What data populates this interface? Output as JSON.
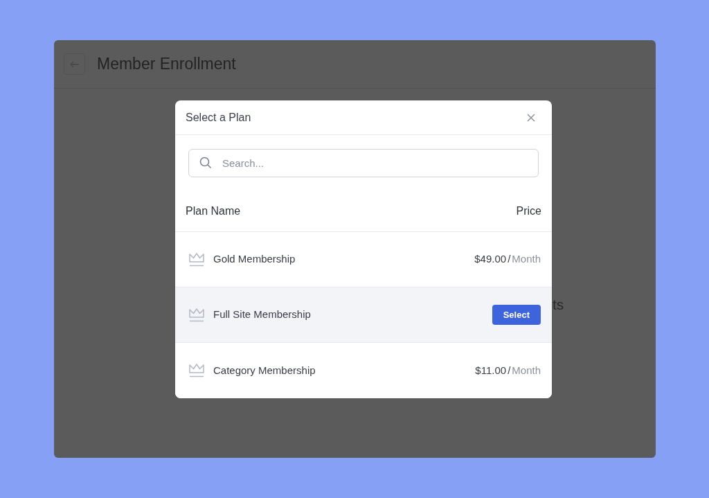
{
  "page": {
    "title": "Member Enrollment",
    "background_text": "ts"
  },
  "dialog": {
    "title": "Select a Plan",
    "search": {
      "placeholder": "Search..."
    },
    "columns": [
      "Plan Name",
      "Price"
    ],
    "rows": [
      {
        "name": "Gold Membership",
        "price": "$49.00",
        "separator": "/",
        "period": "Month",
        "highlighted": false
      },
      {
        "name": "Full Site Membership",
        "action": "Select",
        "highlighted": true
      },
      {
        "name": "Category Membership",
        "price": "$11.00",
        "separator": "/",
        "period": "Month",
        "highlighted": false
      }
    ]
  }
}
